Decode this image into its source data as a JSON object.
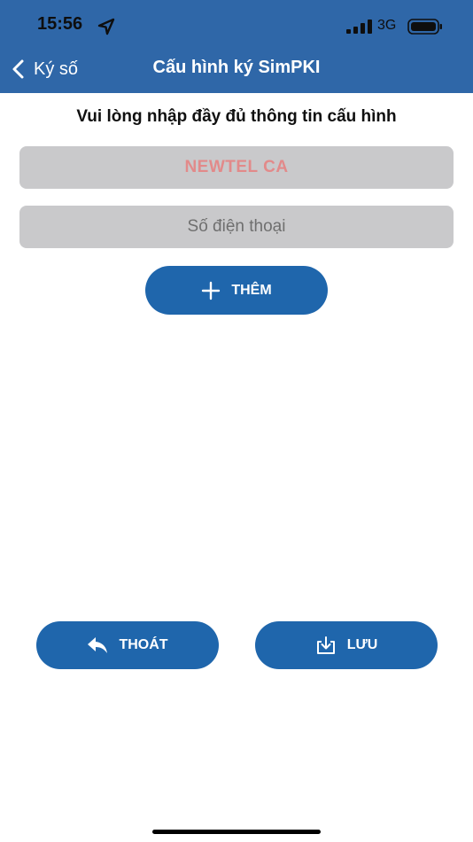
{
  "status_bar": {
    "time": "15:56",
    "network": "3G",
    "icons": [
      "location-arrow-icon",
      "signal-icon",
      "battery-icon"
    ]
  },
  "nav": {
    "back_label": "Ký số",
    "title": "Cấu hình ký SimPKI"
  },
  "form": {
    "heading": "Vui lòng nhập đầy đủ thông tin cấu hình",
    "provider_value": "NEWTEL CA",
    "phone_placeholder": "Số điện thoại",
    "add_label": "THÊM"
  },
  "actions": {
    "exit_label": "THOÁT",
    "save_label": "LƯU"
  },
  "colors": {
    "header": "#2f67a8",
    "button": "#1f66ac",
    "field": "#c9c9cb",
    "provider_text": "#e28a8a"
  }
}
